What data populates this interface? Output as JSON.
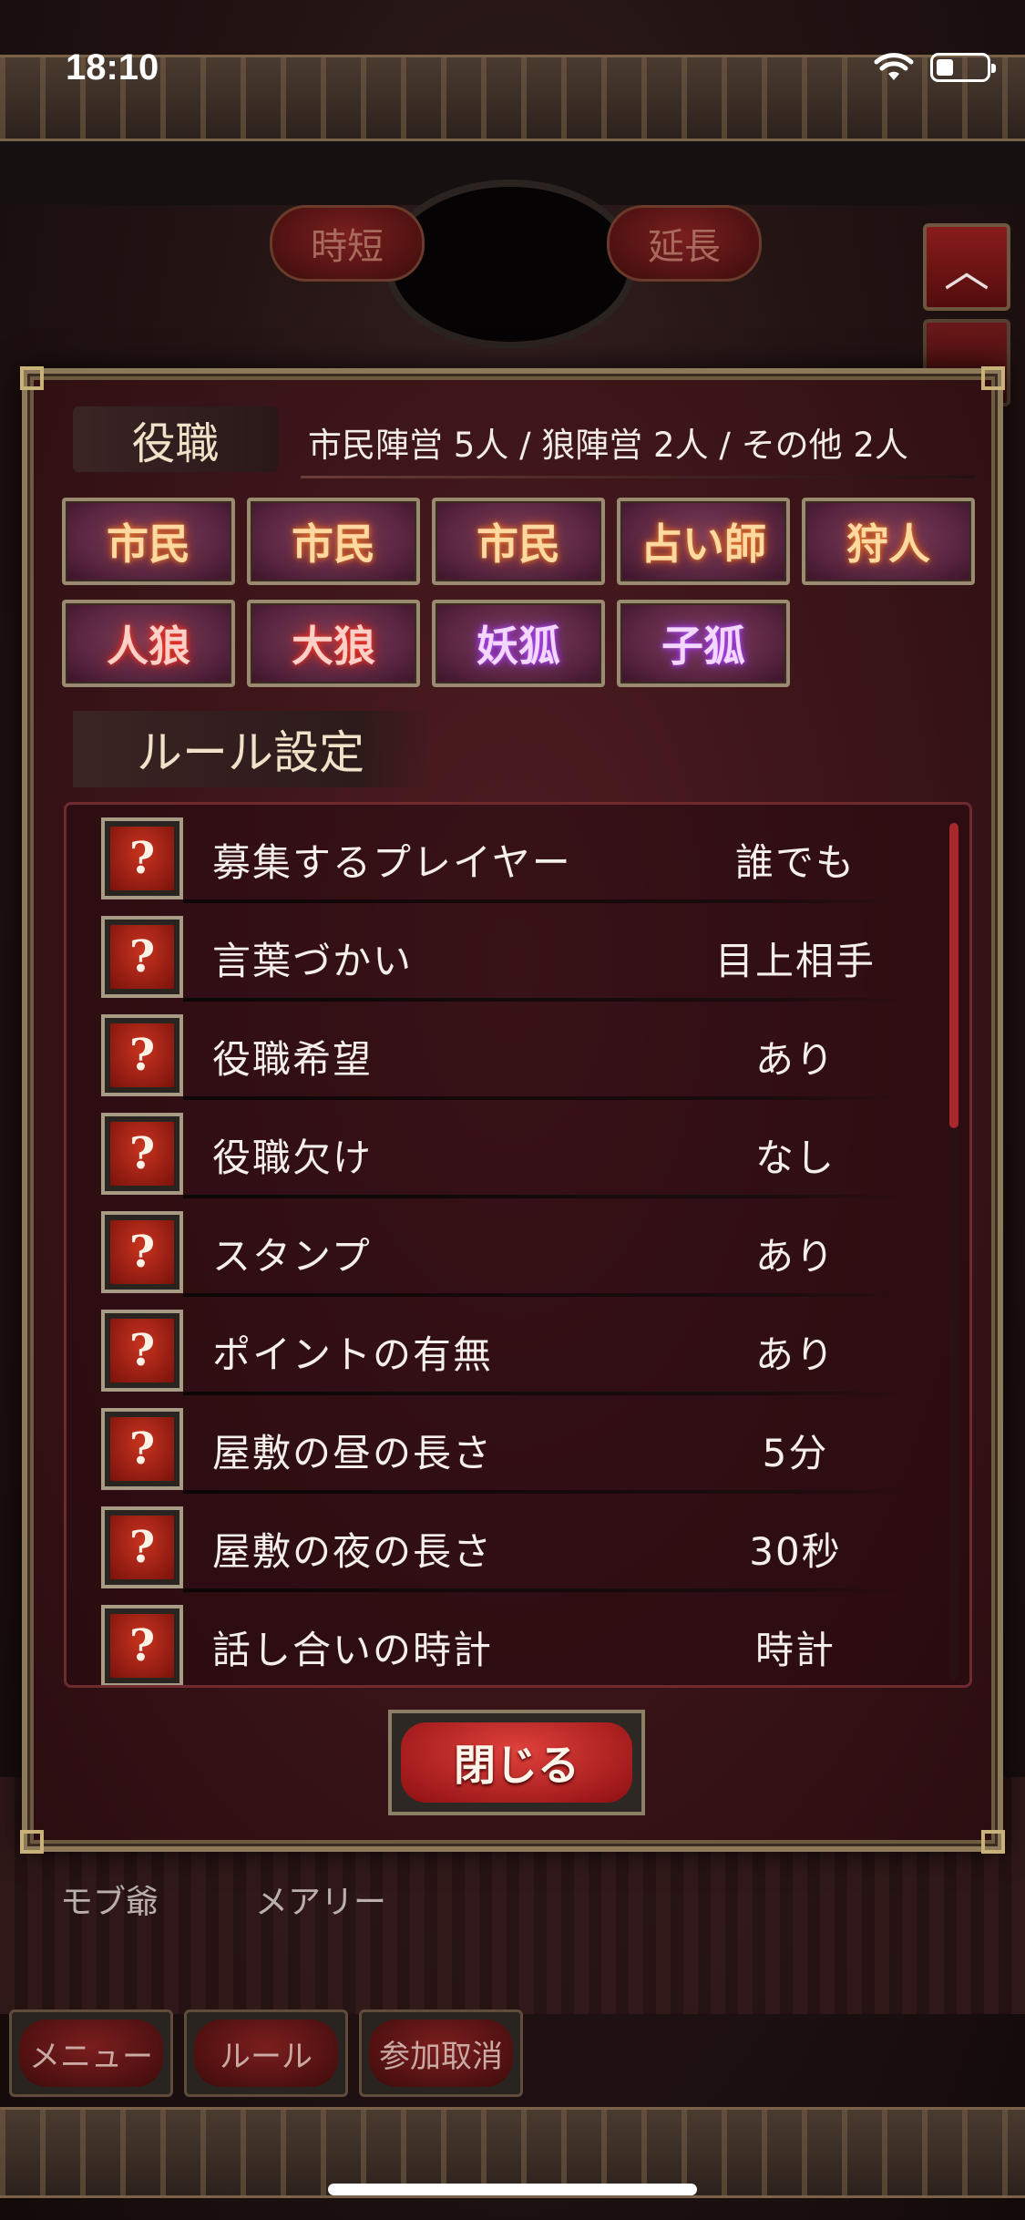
{
  "status_bar": {
    "time": "18:10",
    "wifi_icon": "wifi-icon",
    "battery_icon": "battery-icon"
  },
  "top_controls": {
    "shorten_label": "時短",
    "extend_label": "延長",
    "scroll_icon": "chevron-up-icon"
  },
  "players": [
    "モブ爺",
    "メアリー"
  ],
  "bottom_nav": {
    "menu": "メニュー",
    "rules": "ルール",
    "cancel": "参加取消"
  },
  "dialog": {
    "roles_title": "役職",
    "roles_summary": "市民陣営 5人 / 狼陣営 2人 / その他 2人",
    "roles": [
      {
        "label": "市民",
        "team": "town"
      },
      {
        "label": "市民",
        "team": "town"
      },
      {
        "label": "市民",
        "team": "town"
      },
      {
        "label": "占い師",
        "team": "town"
      },
      {
        "label": "狩人",
        "team": "town"
      },
      {
        "label": "人狼",
        "team": "wolf"
      },
      {
        "label": "大狼",
        "team": "wolf"
      },
      {
        "label": "妖狐",
        "team": "fox"
      },
      {
        "label": "子狐",
        "team": "fox"
      }
    ],
    "rules_title": "ルール設定",
    "help_glyph": "?",
    "rules": [
      {
        "name": "募集するプレイヤー",
        "value": "誰でも"
      },
      {
        "name": "言葉づかい",
        "value": "目上相手"
      },
      {
        "name": "役職希望",
        "value": "あり"
      },
      {
        "name": "役職欠け",
        "value": "なし"
      },
      {
        "name": "スタンプ",
        "value": "あり"
      },
      {
        "name": "ポイントの有無",
        "value": "あり"
      },
      {
        "name": "屋敷の昼の長さ",
        "value": "5分"
      },
      {
        "name": "屋敷の夜の長さ",
        "value": "30秒"
      },
      {
        "name": "話し合いの時計",
        "value": "時計"
      }
    ],
    "close_label": "閉じる"
  },
  "colors": {
    "town_glow": "#e27a2b",
    "wolf_glow": "#ff3a2a",
    "fox_glow": "#b44cff",
    "dialog_bg": "#3a1418"
  }
}
